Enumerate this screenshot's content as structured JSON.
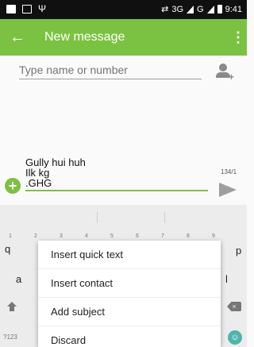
{
  "status_bar": {
    "usb": "Ψ",
    "network": "3G",
    "signal2": "G",
    "time": "9:41"
  },
  "app_bar": {
    "back": "←",
    "title": "New message",
    "overflow": "⋮"
  },
  "recipient": {
    "placeholder": "Type name or number"
  },
  "compose": {
    "attach": "+",
    "text": "Gully hui huh\nIlk kg\n.GHG",
    "counter": "134/1"
  },
  "keyboard": {
    "digits": [
      "1",
      "2",
      "3",
      "4",
      "5",
      "6",
      "7",
      "8",
      "9"
    ],
    "keys": [
      "q",
      "p",
      "a",
      "l"
    ],
    "sym": "?123",
    "emoji": "☺",
    "backspace": "×"
  },
  "menu": {
    "items": [
      "Insert quick text",
      "Insert contact",
      "Add subject",
      "Discard"
    ]
  },
  "colors": {
    "accent": "#7cc242",
    "status_bar": "#101010"
  }
}
